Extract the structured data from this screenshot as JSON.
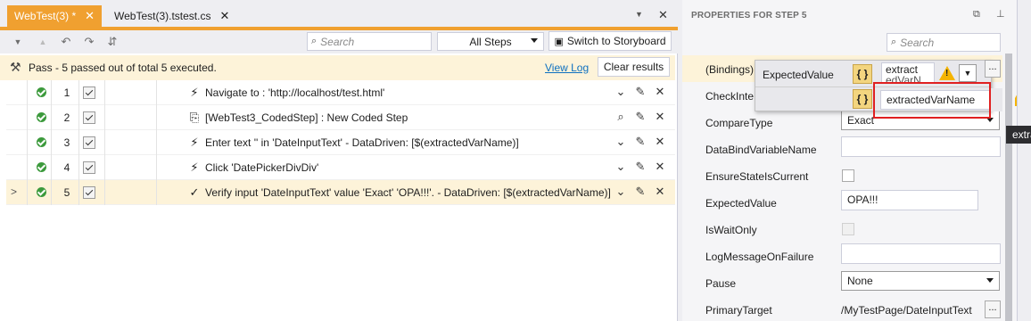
{
  "editor": {
    "tabs": [
      {
        "label": "WebTest(3) *",
        "active": true
      },
      {
        "label": "WebTest(3).tstest.cs",
        "active": false
      }
    ],
    "toolbar": {
      "search_placeholder": "Search",
      "filter_value": "All Steps",
      "storyboard_label": "Switch to Storyboard"
    },
    "status": {
      "text": "Pass - 5 passed out of total 5 executed.",
      "view_log": "View Log",
      "clear_results": "Clear results"
    },
    "steps": [
      {
        "num": "1",
        "icon": "lightning-icon",
        "glyph": "⚡",
        "description": "Navigate to : 'http://localhost/test.html'",
        "actions": [
          "chevron-down-icon",
          "edit-icon",
          "close-icon"
        ],
        "selected": false
      },
      {
        "num": "2",
        "icon": "coded-step-icon",
        "glyph": "⎘",
        "description": "[WebTest3_CodedStep] : New Coded Step",
        "actions": [
          "search-icon",
          "edit-icon",
          "close-icon"
        ],
        "selected": false
      },
      {
        "num": "3",
        "icon": "lightning-icon",
        "glyph": "⚡",
        "description": "Enter text '' in 'DateInputText' - DataDriven: [$(extractedVarName)]",
        "actions": [
          "chevron-down-icon",
          "edit-icon",
          "close-icon"
        ],
        "selected": false
      },
      {
        "num": "4",
        "icon": "lightning-icon",
        "glyph": "⚡",
        "description": "Click 'DatePickerDivDiv'",
        "actions": [
          "chevron-down-icon",
          "edit-icon",
          "close-icon"
        ],
        "selected": false
      },
      {
        "num": "5",
        "icon": "checkmark-icon",
        "glyph": "✓",
        "description": "Verify input 'DateInputText' value 'Exact' 'OPA!!!'. - DataDriven: [$(extractedVarName)]",
        "actions": [
          "chevron-down-icon",
          "edit-icon",
          "close-icon"
        ],
        "selected": true
      }
    ]
  },
  "props": {
    "title": "PROPERTIES FOR STEP 5",
    "search_placeholder": "Search",
    "rows": [
      {
        "label": "(Bindings)",
        "kind": "text",
        "value": ""
      },
      {
        "label": "CheckInte",
        "kind": "text",
        "value": ""
      },
      {
        "label": "CompareType",
        "kind": "select",
        "value": "Exact"
      },
      {
        "label": "DataBindVariableName",
        "kind": "input",
        "value": ""
      },
      {
        "label": "EnsureStateIsCurrent",
        "kind": "checkbox",
        "value": ""
      },
      {
        "label": "ExpectedValue",
        "kind": "input",
        "value": "OPA!!!"
      },
      {
        "label": "IsWaitOnly",
        "kind": "checkbox",
        "value": ""
      },
      {
        "label": "LogMessageOnFailure",
        "kind": "input",
        "value": ""
      },
      {
        "label": "Pause",
        "kind": "select",
        "value": "None"
      },
      {
        "label": "PrimaryTarget",
        "kind": "text",
        "value": "/MyTestPage/DateInputText"
      }
    ],
    "binding_popup": {
      "label": "ExpectedValue",
      "value": "extract",
      "value_overflow": "edVarN",
      "input_value": "extractedVarName"
    },
    "tooltip": "extra"
  }
}
